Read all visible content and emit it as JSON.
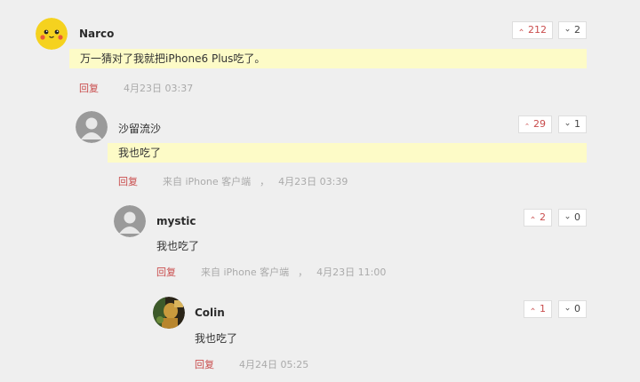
{
  "reply_label": "回复",
  "comments": [
    {
      "username": "Narco",
      "avatar": "pikachu-avatar",
      "content": "万一猜对了我就把iPhone6 Plus吃了。",
      "highlighted": true,
      "source": "",
      "time": "4月23日 03:37",
      "upvotes": "212",
      "downvotes": "2"
    },
    {
      "username": "沙留流沙",
      "avatar": "default-user-avatar",
      "content": "我也吃了",
      "highlighted": true,
      "source": "来自 iPhone 客户端",
      "time": "4月23日 03:39",
      "upvotes": "29",
      "downvotes": "1"
    },
    {
      "username": "mystic",
      "avatar": "default-user-avatar",
      "content": "我也吃了",
      "highlighted": false,
      "source": "来自 iPhone 客户端",
      "time": "4月23日 11:00",
      "upvotes": "2",
      "downvotes": "0"
    },
    {
      "username": "Colin",
      "avatar": "photo-avatar",
      "content": "我也吃了",
      "highlighted": false,
      "source": "",
      "time": "4月24日 05:25",
      "upvotes": "1",
      "downvotes": "0"
    }
  ],
  "separator": "，",
  "colors": {
    "accent": "#c94c4c",
    "highlight": "#fdfbc7",
    "background": "#efefef"
  }
}
